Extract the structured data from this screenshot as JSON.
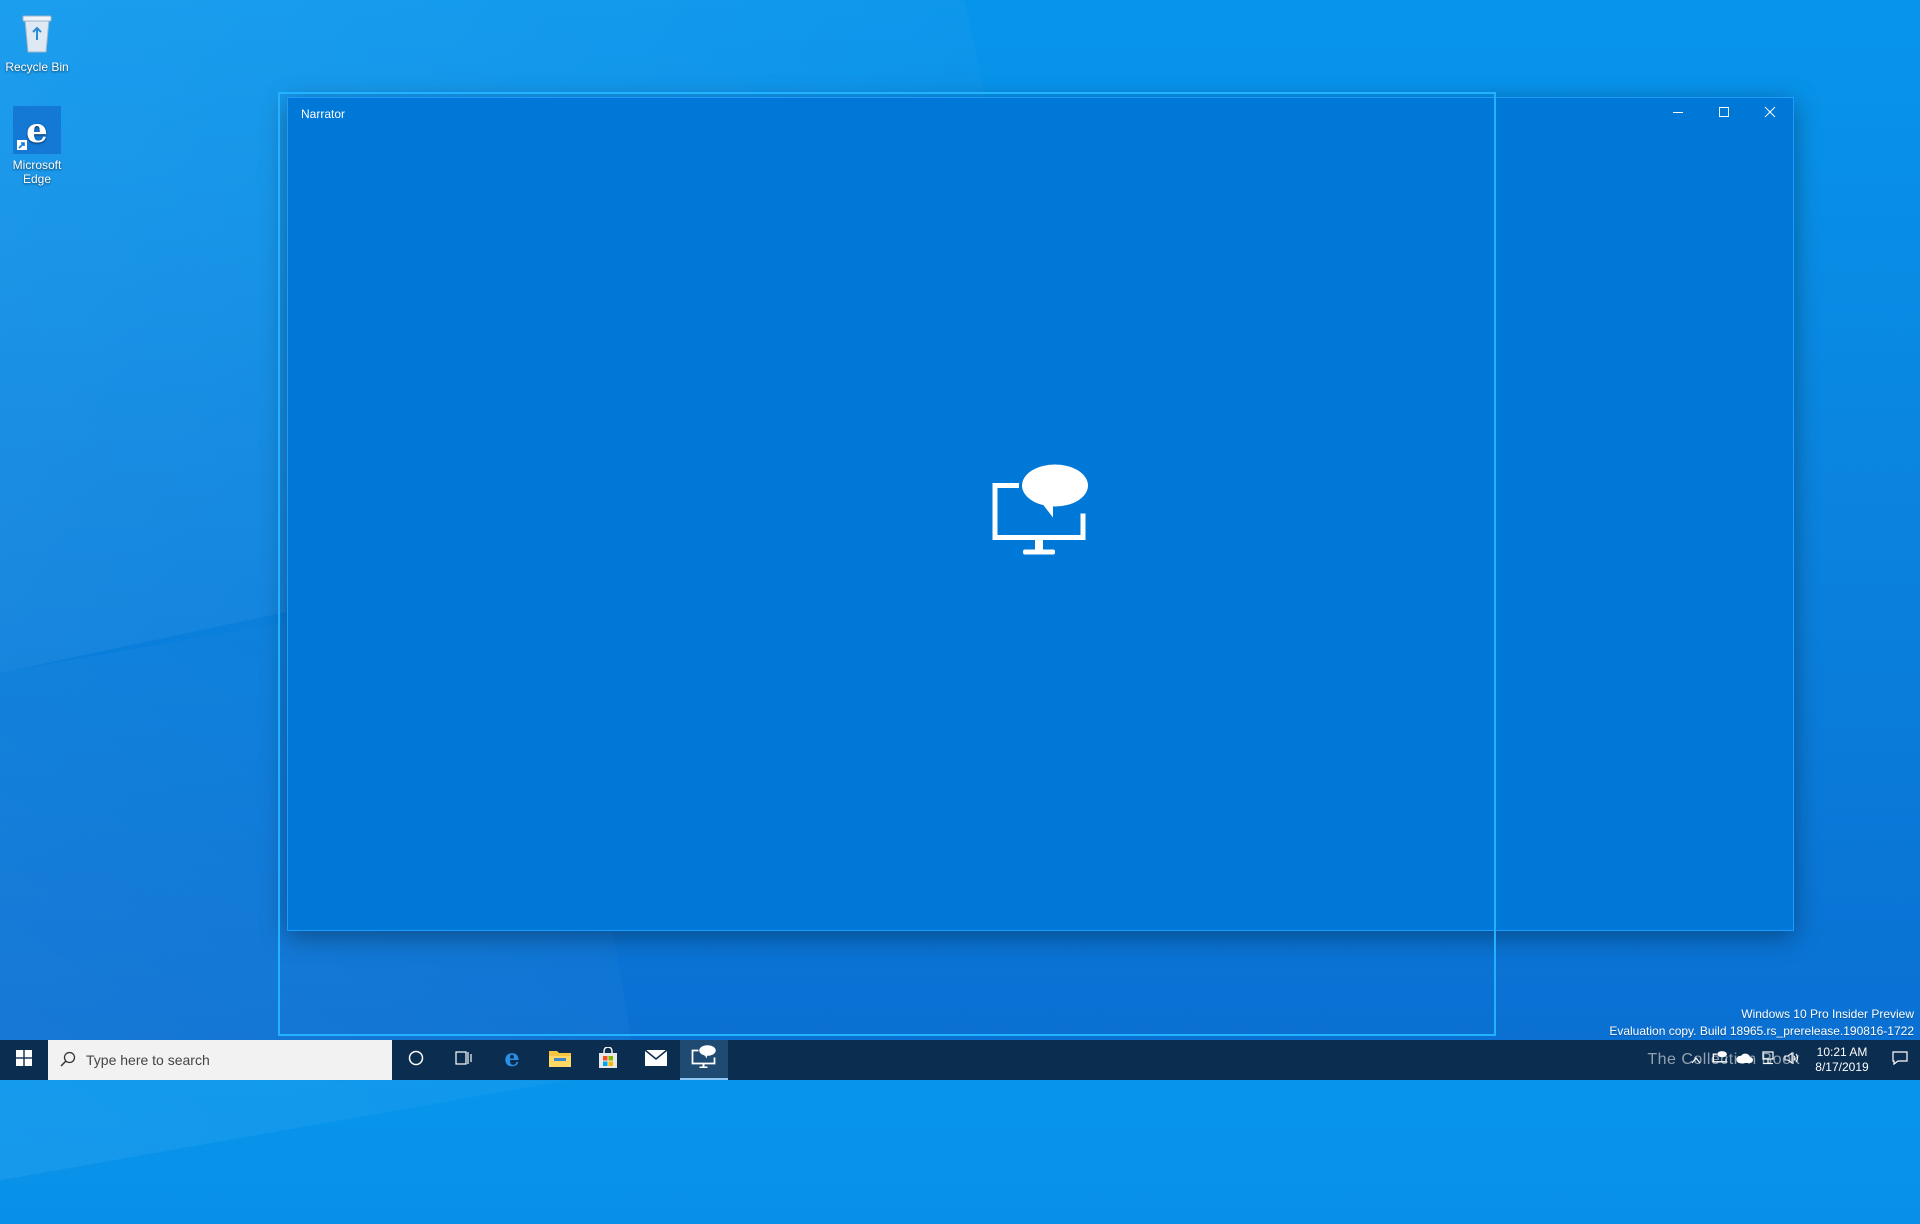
{
  "desktop": {
    "icons": [
      {
        "label": "Recycle Bin"
      },
      {
        "label": "Microsoft Edge"
      }
    ]
  },
  "window": {
    "title": "Narrator",
    "background": "#0078d7",
    "logo_icon": "narrator-icon"
  },
  "watermark": {
    "line1": "Windows 10 Pro Insider Preview",
    "line2": "Evaluation copy. Build 18965.rs_prerelease.190816-1722"
  },
  "taskbar": {
    "search_placeholder": "Type here to search",
    "pinned": [
      "cortana-icon",
      "task-view-icon",
      "edge-icon",
      "file-explorer-icon",
      "store-icon",
      "mail-icon",
      "narrator-icon"
    ],
    "badge_text": "The Collection Book",
    "clock": {
      "time": "10:21 AM",
      "date": "8/17/2019"
    }
  }
}
